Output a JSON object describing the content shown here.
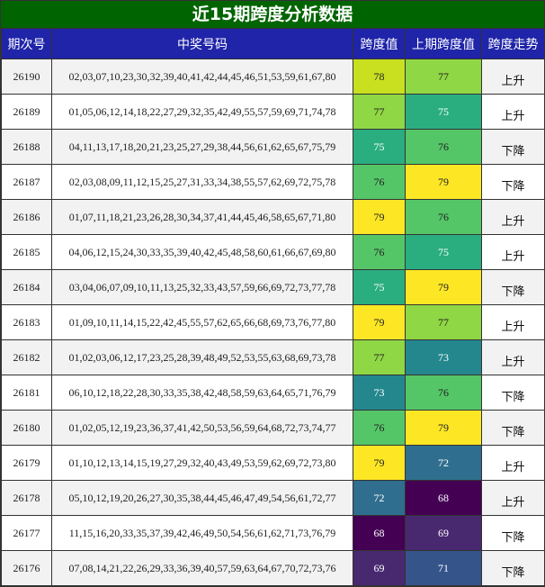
{
  "title": "近15期跨度分析数据",
  "headers": [
    "期次号",
    "中奖号码",
    "跨度值",
    "上期跨度值",
    "跨度走势"
  ],
  "colors": {
    "68": "#440154",
    "69": "#48286f",
    "71": "#35548a",
    "72": "#2f6e8e",
    "73": "#24878e",
    "75": "#2aae80",
    "76": "#55c667",
    "77": "#8fd744",
    "78": "#c8e020",
    "79": "#fde725"
  },
  "rows": [
    {
      "issue": "26190",
      "numbers": "02,03,07,10,23,30,32,39,40,41,42,44,45,46,51,53,59,61,67,80",
      "span": "78",
      "prev_span": "77",
      "trend": "上升"
    },
    {
      "issue": "26189",
      "numbers": "01,05,06,12,14,18,22,27,29,32,35,42,49,55,57,59,69,71,74,78",
      "span": "77",
      "prev_span": "75",
      "trend": "上升"
    },
    {
      "issue": "26188",
      "numbers": "04,11,13,17,18,20,21,23,25,27,29,38,44,56,61,62,65,67,75,79",
      "span": "75",
      "prev_span": "76",
      "trend": "下降"
    },
    {
      "issue": "26187",
      "numbers": "02,03,08,09,11,12,15,25,27,31,33,34,38,55,57,62,69,72,75,78",
      "span": "76",
      "prev_span": "79",
      "trend": "下降"
    },
    {
      "issue": "26186",
      "numbers": "01,07,11,18,21,23,26,28,30,34,37,41,44,45,46,58,65,67,71,80",
      "span": "79",
      "prev_span": "76",
      "trend": "上升"
    },
    {
      "issue": "26185",
      "numbers": "04,06,12,15,24,30,33,35,39,40,42,45,48,58,60,61,66,67,69,80",
      "span": "76",
      "prev_span": "75",
      "trend": "上升"
    },
    {
      "issue": "26184",
      "numbers": "03,04,06,07,09,10,11,13,25,32,33,43,57,59,66,69,72,73,77,78",
      "span": "75",
      "prev_span": "79",
      "trend": "下降"
    },
    {
      "issue": "26183",
      "numbers": "01,09,10,11,14,15,22,42,45,55,57,62,65,66,68,69,73,76,77,80",
      "span": "79",
      "prev_span": "77",
      "trend": "上升"
    },
    {
      "issue": "26182",
      "numbers": "01,02,03,06,12,17,23,25,28,39,48,49,52,53,55,63,68,69,73,78",
      "span": "77",
      "prev_span": "73",
      "trend": "上升"
    },
    {
      "issue": "26181",
      "numbers": "06,10,12,18,22,28,30,33,35,38,42,48,58,59,63,64,65,71,76,79",
      "span": "73",
      "prev_span": "76",
      "trend": "下降"
    },
    {
      "issue": "26180",
      "numbers": "01,02,05,12,19,23,36,37,41,42,50,53,56,59,64,68,72,73,74,77",
      "span": "76",
      "prev_span": "79",
      "trend": "下降"
    },
    {
      "issue": "26179",
      "numbers": "01,10,12,13,14,15,19,27,29,32,40,43,49,53,59,62,69,72,73,80",
      "span": "79",
      "prev_span": "72",
      "trend": "上升"
    },
    {
      "issue": "26178",
      "numbers": "05,10,12,19,20,26,27,30,35,38,44,45,46,47,49,54,56,61,72,77",
      "span": "72",
      "prev_span": "68",
      "trend": "上升"
    },
    {
      "issue": "26177",
      "numbers": "11,15,16,20,33,35,37,39,42,46,49,50,54,56,61,62,71,73,76,79",
      "span": "68",
      "prev_span": "69",
      "trend": "下降"
    },
    {
      "issue": "26176",
      "numbers": "07,08,14,21,22,26,29,33,36,39,40,57,59,63,64,67,70,72,73,76",
      "span": "69",
      "prev_span": "71",
      "trend": "下降"
    }
  ]
}
